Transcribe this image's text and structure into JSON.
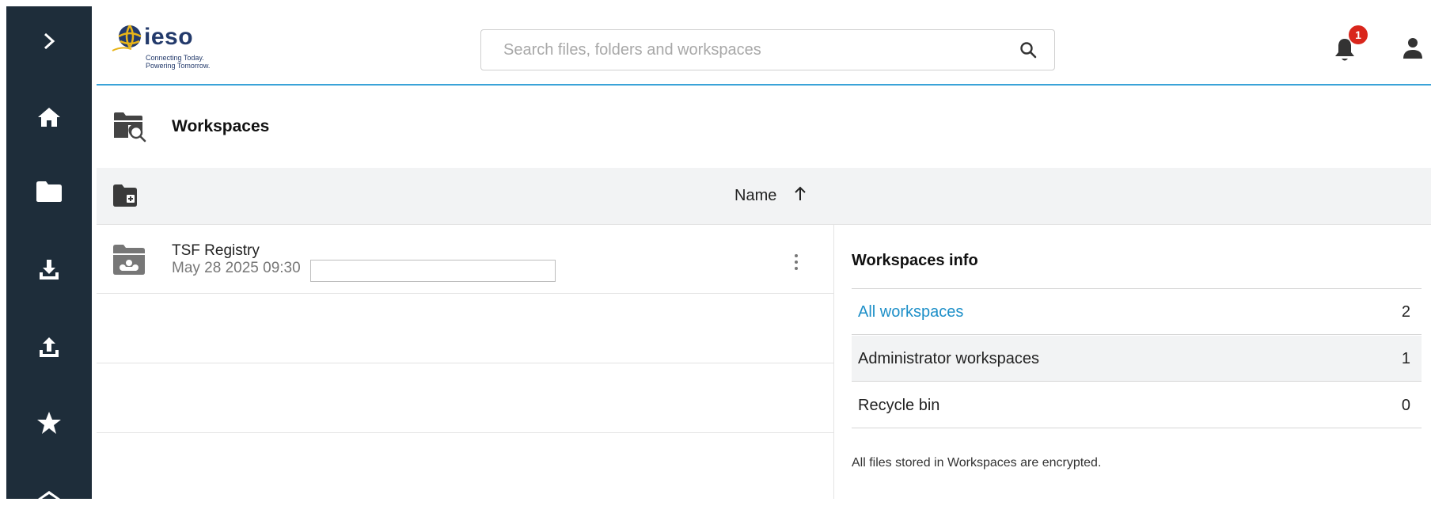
{
  "header": {
    "logo_word": "ieso",
    "logo_tagline_1": "Connecting Today.",
    "logo_tagline_2": "Powering Tomorrow.",
    "search_placeholder": "Search files, folders and workspaces",
    "notification_count": "1"
  },
  "rail": {
    "items": [
      "chevron-right-icon",
      "home-icon",
      "folder-icon",
      "download-icon",
      "upload-icon",
      "star-icon",
      "more-icon"
    ]
  },
  "page": {
    "title": "Workspaces"
  },
  "list": {
    "sort_column": "Name",
    "sort_direction": "ascending",
    "rows": [
      {
        "name": "TSF Registry",
        "date": "May 28 2025 09:30"
      }
    ]
  },
  "info": {
    "title": "Workspaces info",
    "items": [
      {
        "label": "All workspaces",
        "count": "2"
      },
      {
        "label": "Administrator workspaces",
        "count": "1"
      },
      {
        "label": "Recycle bin",
        "count": "0"
      }
    ],
    "note": "All files stored in Workspaces are encrypted."
  },
  "colors": {
    "rail": "#1e2d3a",
    "accent": "#3aa3d8",
    "link": "#1d8fc8",
    "badge": "#d9261c"
  }
}
